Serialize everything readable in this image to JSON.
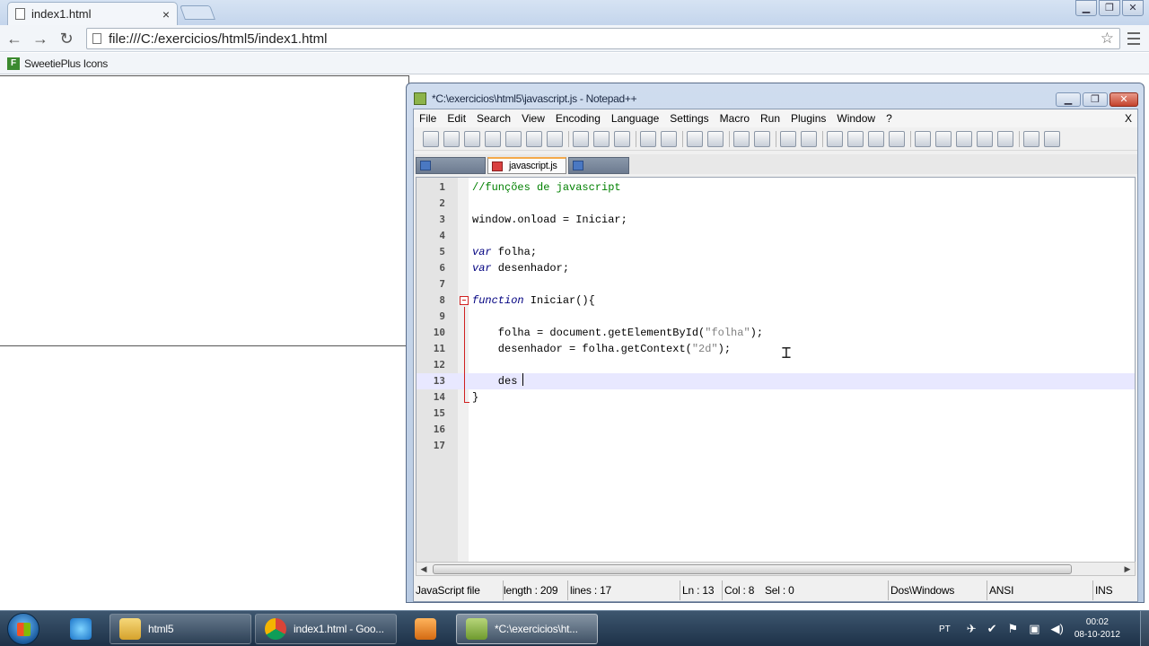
{
  "browser": {
    "tab_title": "index1.html",
    "tab_close": "×",
    "address": "file:///C:/exercicios/html5/index1.html",
    "bookmark_label": "SweetiePlus Icons",
    "bookmark_icon_letter": "F"
  },
  "notepad": {
    "title": "*C:\\exercicios\\html5\\javascript.js - Notepad++",
    "menu": [
      "File",
      "Edit",
      "Search",
      "View",
      "Encoding",
      "Language",
      "Settings",
      "Macro",
      "Run",
      "Plugins",
      "Window",
      "?"
    ],
    "menu_close": "X",
    "active_tab": "javascript.js",
    "code_lines": [
      {
        "n": "1",
        "text": "//funções de javascript"
      },
      {
        "n": "2",
        "text": ""
      },
      {
        "n": "3",
        "text": "window.onload = Iniciar;"
      },
      {
        "n": "4",
        "text": ""
      },
      {
        "n": "5",
        "text": "var folha;"
      },
      {
        "n": "6",
        "text": "var desenhador;"
      },
      {
        "n": "7",
        "text": ""
      },
      {
        "n": "8",
        "text": "function Iniciar(){"
      },
      {
        "n": "9",
        "text": ""
      },
      {
        "n": "10",
        "text": "    folha = document.getElementById(\"folha\");"
      },
      {
        "n": "11",
        "text": "    desenhador = folha.getContext(\"2d\");"
      },
      {
        "n": "12",
        "text": ""
      },
      {
        "n": "13",
        "text": "    des"
      },
      {
        "n": "14",
        "text": "}"
      },
      {
        "n": "15",
        "text": ""
      },
      {
        "n": "16",
        "text": ""
      },
      {
        "n": "17",
        "text": ""
      }
    ],
    "status": {
      "filetype": "JavaScript file",
      "length": "length : 209",
      "lines": "lines : 17",
      "ln": "Ln : 13",
      "col": "Col : 8",
      "sel": "Sel : 0",
      "eol": "Dos\\Windows",
      "encoding": "ANSI",
      "mode": "INS"
    }
  },
  "taskbar": {
    "items": [
      "html5",
      "index1.html - Goo...",
      "*C:\\exercicios\\ht..."
    ],
    "language": "PT",
    "time": "00:02",
    "date": "08-10-2012"
  },
  "colors": {
    "comment": "#008000",
    "keyword": "#000080",
    "string": "#808080",
    "current_line": "#e8e8ff",
    "fold_marker": "#d02020"
  }
}
